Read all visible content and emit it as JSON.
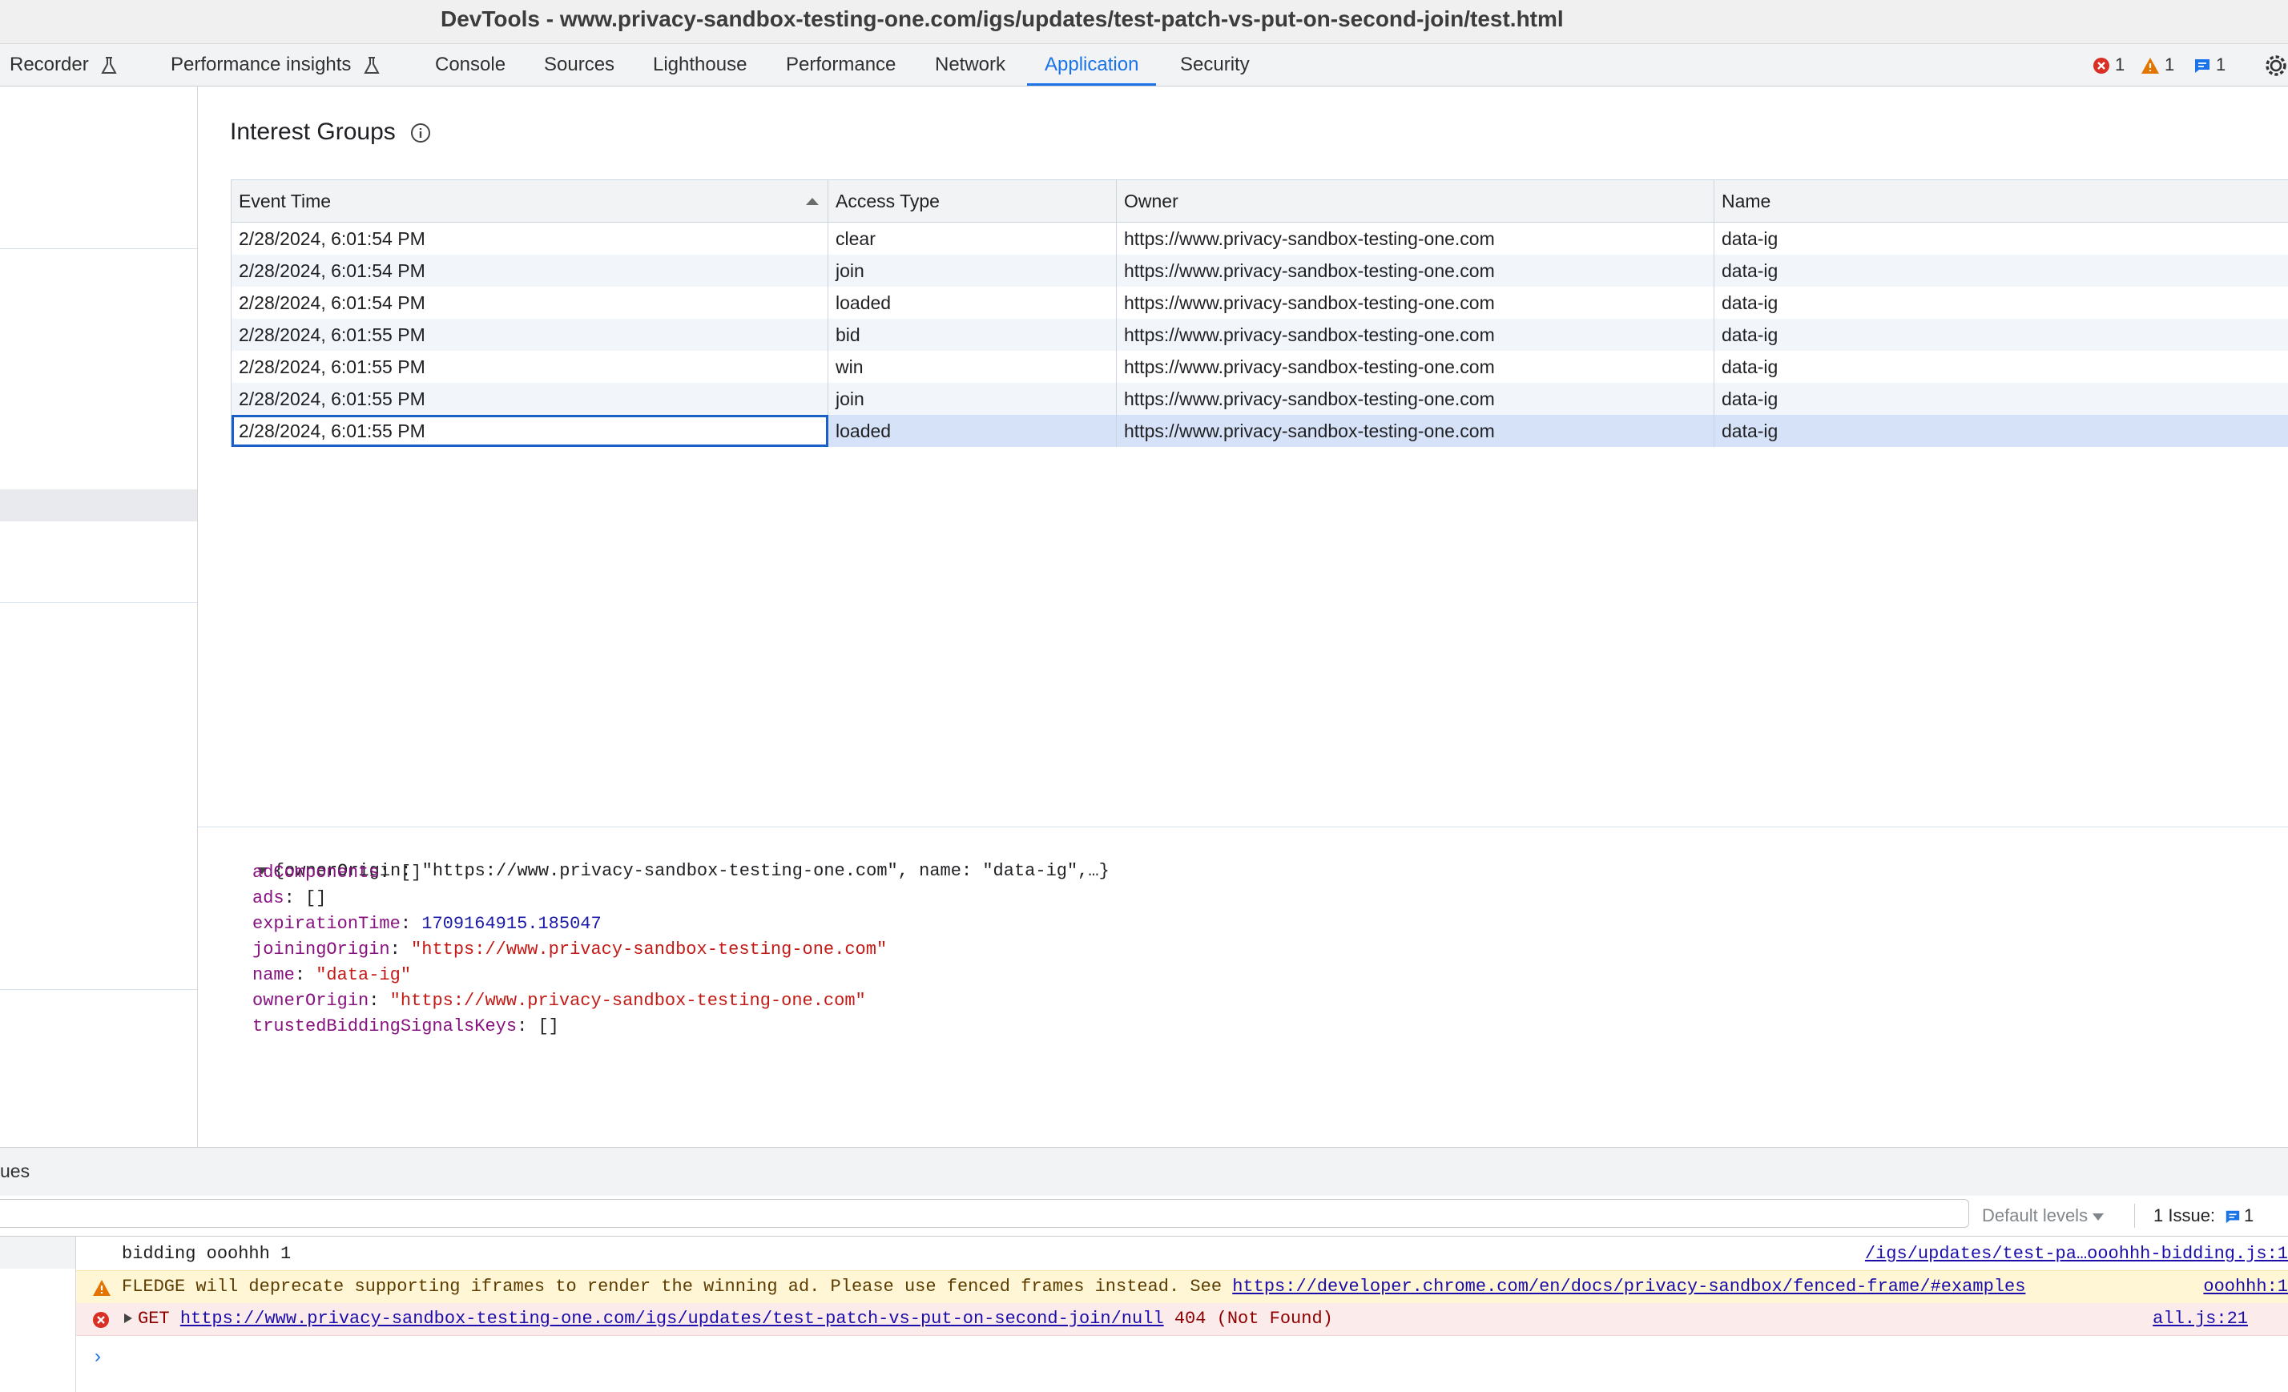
{
  "window": {
    "title": "DevTools - www.privacy-sandbox-testing-one.com/igs/updates/test-patch-vs-put-on-second-join/test.html"
  },
  "tabs": [
    {
      "label": "Recorder",
      "experimental": true
    },
    {
      "label": "Performance insights",
      "experimental": true
    },
    {
      "label": "Console"
    },
    {
      "label": "Sources"
    },
    {
      "label": "Lighthouse"
    },
    {
      "label": "Performance"
    },
    {
      "label": "Network"
    },
    {
      "label": "Application",
      "active": true
    },
    {
      "label": "Security"
    }
  ],
  "counters": {
    "errors": "1",
    "warnings": "1",
    "messages": "1"
  },
  "panel": {
    "title": "Interest Groups"
  },
  "table": {
    "columns": [
      "Event Time",
      "Access Type",
      "Owner",
      "Name"
    ],
    "sort_column": "Event Time",
    "rows": [
      [
        "2/28/2024, 6:01:54 PM",
        "clear",
        "https://www.privacy-sandbox-testing-one.com",
        "data-ig"
      ],
      [
        "2/28/2024, 6:01:54 PM",
        "join",
        "https://www.privacy-sandbox-testing-one.com",
        "data-ig"
      ],
      [
        "2/28/2024, 6:01:54 PM",
        "loaded",
        "https://www.privacy-sandbox-testing-one.com",
        "data-ig"
      ],
      [
        "2/28/2024, 6:01:55 PM",
        "bid",
        "https://www.privacy-sandbox-testing-one.com",
        "data-ig"
      ],
      [
        "2/28/2024, 6:01:55 PM",
        "win",
        "https://www.privacy-sandbox-testing-one.com",
        "data-ig"
      ],
      [
        "2/28/2024, 6:01:55 PM",
        "join",
        "https://www.privacy-sandbox-testing-one.com",
        "data-ig"
      ],
      [
        "2/28/2024, 6:01:55 PM",
        "loaded",
        "https://www.privacy-sandbox-testing-one.com",
        "data-ig"
      ]
    ],
    "selected_row": 6
  },
  "object": {
    "summary": "{ownerOrigin: \"https://www.privacy-sandbox-testing-one.com\", name: \"data-ig\",…}",
    "properties": [
      {
        "key": "adComponents",
        "value": "[]",
        "type": "plain"
      },
      {
        "key": "ads",
        "value": "[]",
        "type": "plain"
      },
      {
        "key": "expirationTime",
        "value": "1709164915.185047",
        "type": "number"
      },
      {
        "key": "joiningOrigin",
        "value": "\"https://www.privacy-sandbox-testing-one.com\"",
        "type": "string"
      },
      {
        "key": "name",
        "value": "\"data-ig\"",
        "type": "string"
      },
      {
        "key": "ownerOrigin",
        "value": "\"https://www.privacy-sandbox-testing-one.com\"",
        "type": "string"
      },
      {
        "key": "trustedBiddingSignalsKeys",
        "value": "[]",
        "type": "plain"
      }
    ]
  },
  "drawer": {
    "tab_label": "ues",
    "default_levels": "Default levels",
    "issues_label": "1 Issue:",
    "issues_count": "1"
  },
  "console": {
    "log": {
      "text": "bidding ooohhh 1",
      "source": "/igs/updates/test-pa…ooohhh-bidding.js:1"
    },
    "warning": {
      "text": "FLEDGE will deprecate supporting iframes to render the winning ad. Please use fenced frames instead. See ",
      "link": "https://developer.chrome.com/en/docs/privacy-sandbox/fenced-frame/#examples",
      "source": "ooohhh:1"
    },
    "error": {
      "method": "GET",
      "url": "https://www.privacy-sandbox-testing-one.com/igs/updates/test-patch-vs-put-on-second-join/null",
      "status": "404 (Not Found)",
      "source": "all.js:21"
    }
  },
  "colors": {
    "accent": "#1a73e8",
    "error": "#d93025",
    "warning": "#e37400",
    "selected_row": "#d6e2f7"
  }
}
